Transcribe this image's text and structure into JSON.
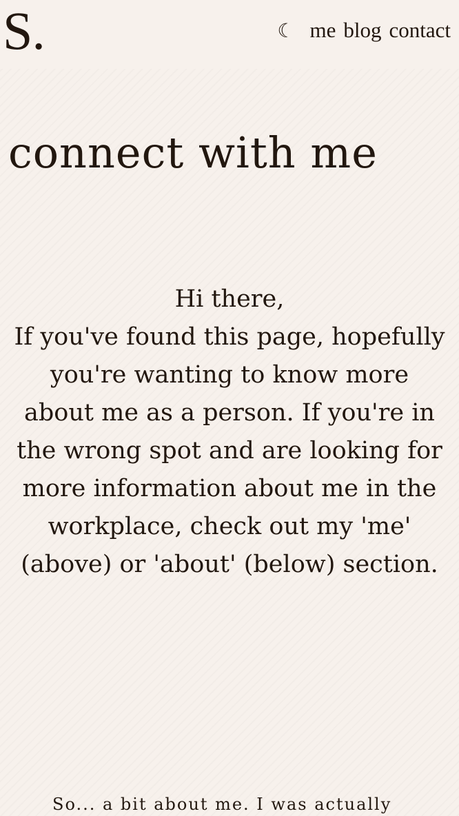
{
  "header": {
    "logo": "S.",
    "theme_toggle_icon": "moon-icon",
    "theme_toggle_glyph": "☾",
    "nav": {
      "me": "me",
      "blog": "blog",
      "contact": "contact"
    }
  },
  "main": {
    "title": "connect with me",
    "greeting": "Hi there,",
    "intro": "If you've found this page, hopefully you're wanting to know more about me as a person. If you're in the wrong spot and are looking for more information about me in the workplace, check out my 'me' (above) or 'about' (below) section.",
    "about_lead": "So... a bit about me. I was actually"
  },
  "colors": {
    "background": "#f7f1ec",
    "text": "#22170f"
  }
}
